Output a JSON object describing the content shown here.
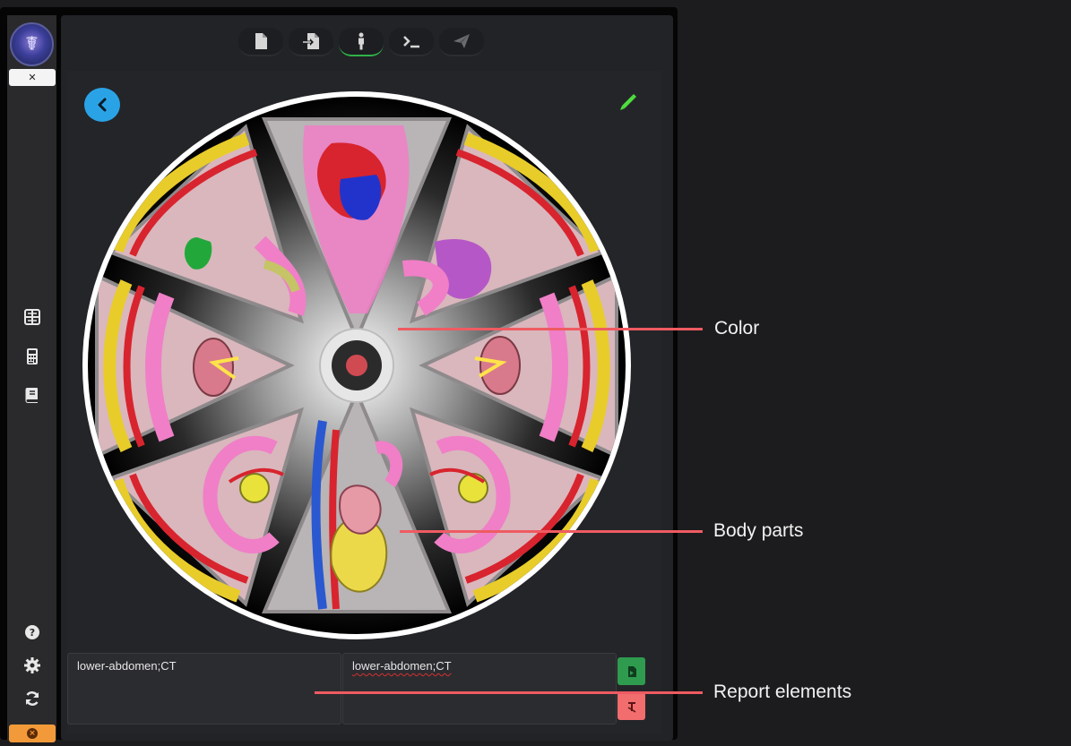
{
  "app": {
    "collapse_icon": "compress-icon",
    "sidebar_icons": [
      "table-list-icon",
      "calculator-icon",
      "book-icon",
      "help-icon",
      "gear-icon",
      "refresh-icon"
    ],
    "close_icon": "close-icon"
  },
  "toolbar": {
    "items": [
      {
        "name": "tab-document",
        "icon": "file-icon",
        "active": false
      },
      {
        "name": "tab-import",
        "icon": "file-import-icon",
        "active": false
      },
      {
        "name": "tab-body",
        "icon": "person-icon",
        "active": true
      },
      {
        "name": "tab-terminal",
        "icon": "terminal-icon",
        "active": false
      },
      {
        "name": "tab-send",
        "icon": "paper-plane-icon",
        "active": false
      }
    ]
  },
  "wheel": {
    "segments": [
      "chest-heart",
      "upper-abdomen-right",
      "kidney-right",
      "pelvis-female-right",
      "lower-abdomen-pelvis",
      "pelvis-female-left",
      "kidney-left",
      "upper-abdomen-left"
    ],
    "center": "color-selector"
  },
  "report": {
    "left_text": "lower-abdomen;CT",
    "right_text": "lower-abdomen;CT"
  },
  "annotations": {
    "color": "Color",
    "body_parts": "Body parts",
    "report_elements": "Report elements"
  },
  "colors": {
    "accent_green": "#2fb24a",
    "back_blue": "#2aa3e6",
    "annotation_red": "#ef5b62",
    "close_orange": "#f29a3a"
  }
}
